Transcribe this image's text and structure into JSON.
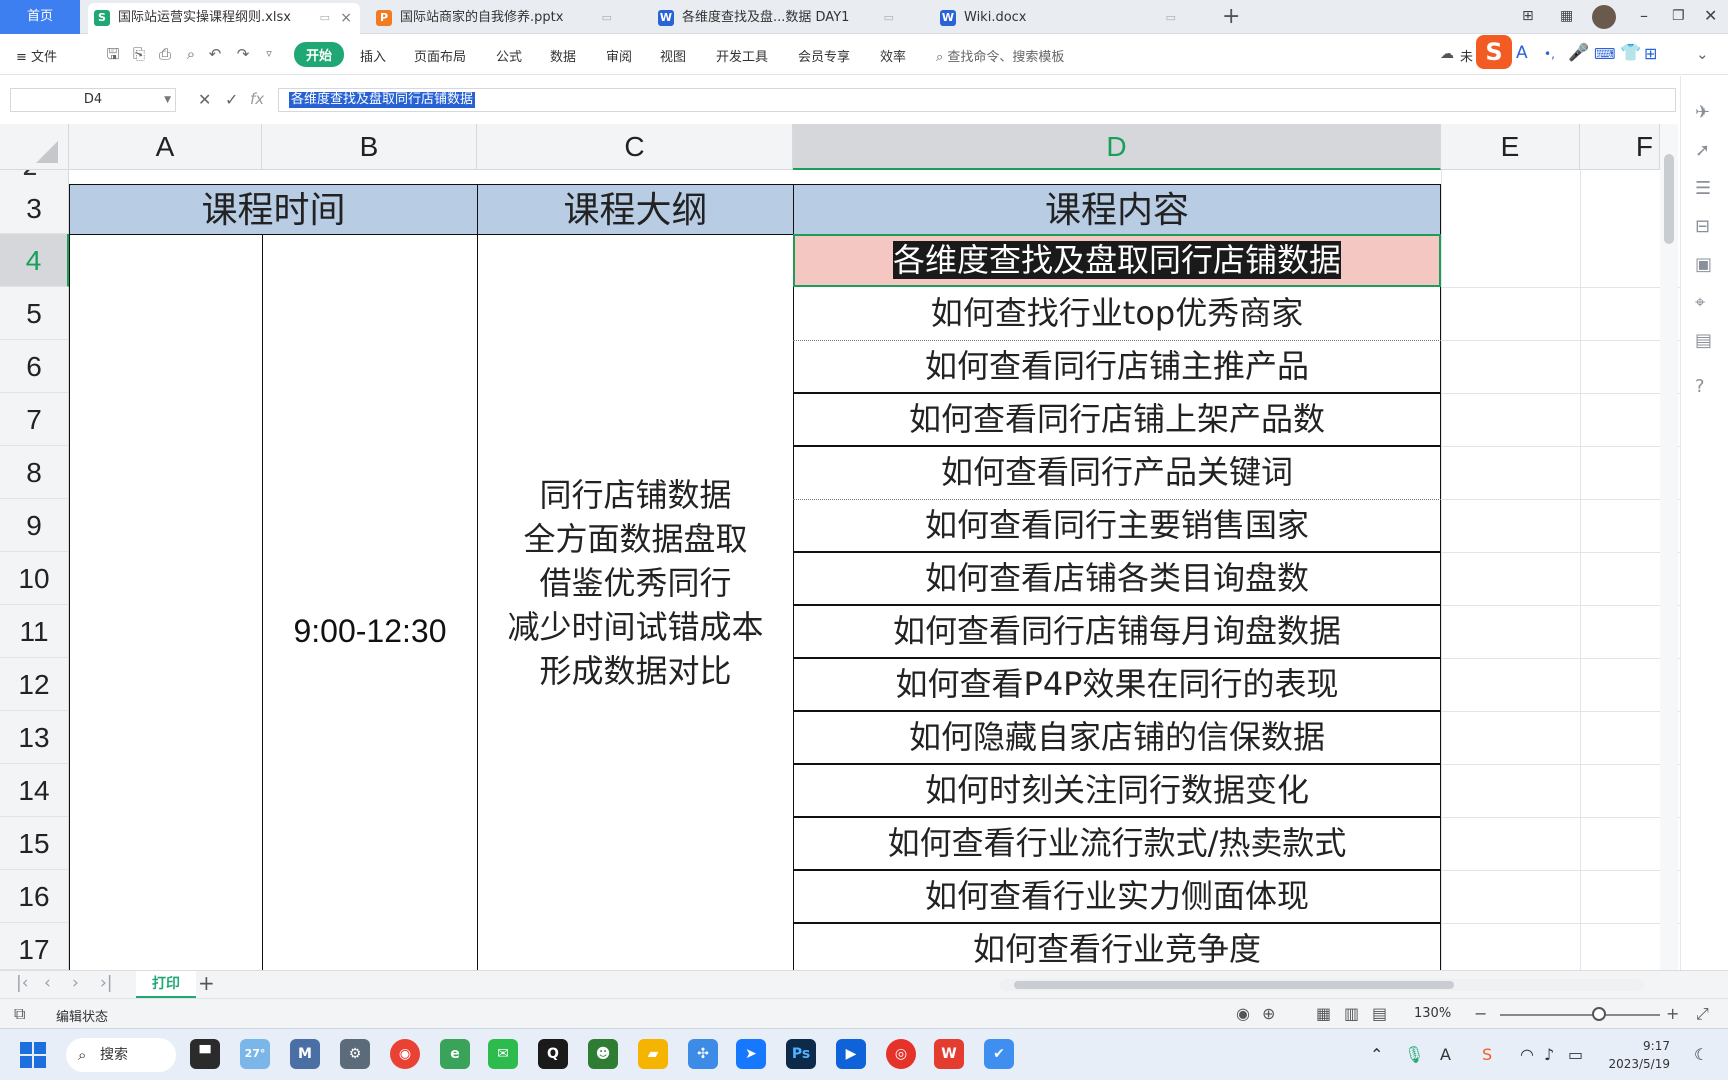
{
  "tabs": {
    "home": "首页",
    "docs": [
      {
        "label": "国际站运营实操课程纲则.xlsx",
        "app": "S",
        "color": "#1fa774"
      },
      {
        "label": "国际站商家的自我修养.pptx",
        "app": "P",
        "color": "#f07b22"
      },
      {
        "label": "各维度查找及盘...数据 DAY1",
        "app": "W",
        "color": "#2a62d8"
      },
      {
        "label": "Wiki.docx",
        "app": "W",
        "color": "#2a62d8"
      }
    ],
    "close_glyph": "×",
    "add_glyph": "+"
  },
  "ribbon": {
    "file": "≡ 文件",
    "tabs": [
      "开始",
      "插入",
      "页面布局",
      "公式",
      "数据",
      "审阅",
      "视图",
      "开发工具",
      "会员专享",
      "效率"
    ],
    "search": "查找命令、搜索模板",
    "unsaved": "未"
  },
  "formula_bar": {
    "cell_ref": "D4",
    "fx": "fx",
    "value": "各维度查找及盘取同行店铺数据"
  },
  "grid": {
    "columns": [
      "A",
      "B",
      "C",
      "D",
      "E",
      "F"
    ],
    "selected_column": "D",
    "rows": [
      "3",
      "4",
      "5",
      "6",
      "7",
      "8",
      "9",
      "10",
      "11",
      "12",
      "13",
      "14",
      "15",
      "16",
      "17"
    ],
    "partial_row": "2",
    "selected_row": "4",
    "headers": {
      "time": "课程时间",
      "outline": "课程大纲",
      "content": "课程内容"
    },
    "time_value": "9:00-12:30",
    "outline_lines": [
      "同行店铺数据",
      "全方面数据盘取",
      "借鉴优秀同行",
      "减少时间试错成本",
      "形成数据对比"
    ],
    "contents": [
      "各维度查找及盘取同行店铺数据",
      "如何查找行业top优秀商家",
      "如何查看同行店铺主推产品",
      "如何查看同行店铺上架产品数",
      "如何查看同行产品关键词",
      "如何查看同行主要销售国家",
      "如何查看店铺各类目询盘数",
      "如何查看同行店铺每月询盘数据",
      "如何查看P4P效果在同行的表现",
      "如何隐藏自家店铺的信保数据",
      "如何时刻关注同行数据变化",
      "如何查看行业流行款式/热卖款式",
      "如何查看行业实力侧面体现",
      "如何查看行业竞争度"
    ]
  },
  "sheet_tabs": {
    "sheets": [
      "打印"
    ],
    "add": "+"
  },
  "status": {
    "mode": "编辑状态",
    "zoom": "130%"
  },
  "taskbar": {
    "search": "搜索",
    "weather": "27°",
    "time": "9:17",
    "date": "2023/5/19"
  }
}
